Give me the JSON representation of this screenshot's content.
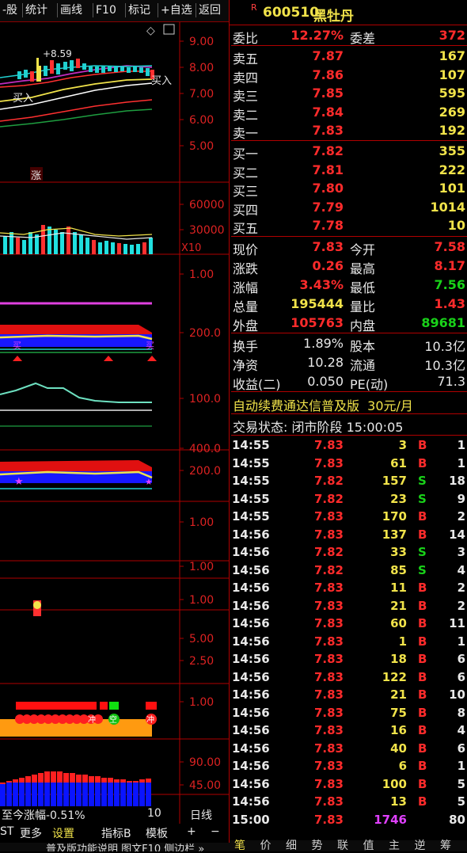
{
  "toolbar": {
    "items": [
      "-股",
      "统计",
      "画线",
      "F10",
      "标记",
      "+自选",
      "返回"
    ]
  },
  "stock": {
    "badge": "R",
    "code": "600510",
    "name": "黑牡丹"
  },
  "chart_axes": {
    "price": [
      "9.00",
      "8.00",
      "7.00",
      "6.00",
      "5.00"
    ],
    "volume": [
      "60000",
      "30000"
    ],
    "volume_mult": "X10",
    "p3": "1.00",
    "p4": "200.0",
    "p5": "100.0",
    "p6": [
      "400.0",
      "200.0"
    ],
    "p7": "1.00",
    "p8": "1.00",
    "p9": "1.00",
    "p10": [
      "5.00",
      "2.50"
    ],
    "p11": "1.00",
    "p12": [
      "90.00",
      "45.00"
    ]
  },
  "chart_labels": {
    "high_mark": "8.59",
    "buy_right": "买入",
    "buy_left": "买入",
    "zhang": "涨",
    "pos_text": "至今涨幅-0.51%",
    "period_count": "10",
    "period": "日线",
    "empty": "空",
    "stop": "冲"
  },
  "bottom": {
    "items": [
      "ST",
      "更多",
      "设置",
      "指标B",
      "模板",
      "+",
      "−"
    ],
    "ticker": "普及版功能说明 图文F10 侧边栏 »"
  },
  "quote": {
    "weibi_label": "委比",
    "weibi": "12.27%",
    "weicha_label": "委差",
    "weicha": "372",
    "asks": [
      {
        "l": "卖五",
        "p": "7.87",
        "v": "167"
      },
      {
        "l": "卖四",
        "p": "7.86",
        "v": "107"
      },
      {
        "l": "卖三",
        "p": "7.85",
        "v": "595"
      },
      {
        "l": "卖二",
        "p": "7.84",
        "v": "269"
      },
      {
        "l": "卖一",
        "p": "7.83",
        "v": "192"
      }
    ],
    "bids": [
      {
        "l": "买一",
        "p": "7.82",
        "v": "355"
      },
      {
        "l": "买二",
        "p": "7.81",
        "v": "222"
      },
      {
        "l": "买三",
        "p": "7.80",
        "v": "101"
      },
      {
        "l": "买四",
        "p": "7.79",
        "v": "1014"
      },
      {
        "l": "买五",
        "p": "7.78",
        "v": "10"
      }
    ],
    "stats": [
      {
        "l1": "现价",
        "v1": "7.83",
        "c1": "red",
        "l2": "今开",
        "v2": "7.58",
        "c2": "red"
      },
      {
        "l1": "涨跌",
        "v1": "0.26",
        "c1": "red",
        "l2": "最高",
        "v2": "8.17",
        "c2": "red"
      },
      {
        "l1": "涨幅",
        "v1": "3.43%",
        "c1": "red",
        "l2": "最低",
        "v2": "7.56",
        "c2": "green"
      },
      {
        "l1": "总量",
        "v1": "195444",
        "c1": "yel",
        "l2": "量比",
        "v2": "1.43",
        "c2": "red"
      },
      {
        "l1": "外盘",
        "v1": "105763",
        "c1": "red",
        "l2": "内盘",
        "v2": "89681",
        "c2": "green"
      }
    ],
    "fin": [
      {
        "l1": "换手",
        "v1": "1.89%",
        "l2": "股本",
        "v2": "10.3亿"
      },
      {
        "l1": "净资",
        "v1": "10.28",
        "l2": "流通",
        "v2": "10.3亿"
      },
      {
        "l1": "收益(二)",
        "v1": "0.050",
        "l2": "PE(动)",
        "v2": "71.3"
      }
    ],
    "promo": "自动续费通达信普及版  30元/月",
    "status": "交易状态: 闭市阶段 15:00:05"
  },
  "ticks": [
    [
      "14:55",
      "7.83",
      "3",
      "B",
      "1"
    ],
    [
      "14:55",
      "7.83",
      "61",
      "B",
      "1"
    ],
    [
      "14:55",
      "7.82",
      "157",
      "S",
      "18"
    ],
    [
      "14:55",
      "7.82",
      "23",
      "S",
      "9"
    ],
    [
      "14:55",
      "7.83",
      "170",
      "B",
      "2"
    ],
    [
      "14:56",
      "7.83",
      "137",
      "B",
      "14"
    ],
    [
      "14:56",
      "7.82",
      "33",
      "S",
      "3"
    ],
    [
      "14:56",
      "7.82",
      "85",
      "S",
      "4"
    ],
    [
      "14:56",
      "7.83",
      "11",
      "B",
      "2"
    ],
    [
      "14:56",
      "7.83",
      "21",
      "B",
      "2"
    ],
    [
      "14:56",
      "7.83",
      "60",
      "B",
      "11"
    ],
    [
      "14:56",
      "7.83",
      "1",
      "B",
      "1"
    ],
    [
      "14:56",
      "7.83",
      "18",
      "B",
      "6"
    ],
    [
      "14:56",
      "7.83",
      "122",
      "B",
      "6"
    ],
    [
      "14:56",
      "7.83",
      "21",
      "B",
      "10"
    ],
    [
      "14:56",
      "7.83",
      "75",
      "B",
      "8"
    ],
    [
      "14:56",
      "7.83",
      "16",
      "B",
      "4"
    ],
    [
      "14:56",
      "7.83",
      "40",
      "B",
      "6"
    ],
    [
      "14:56",
      "7.83",
      "6",
      "B",
      "1"
    ],
    [
      "14:56",
      "7.83",
      "100",
      "B",
      "5"
    ],
    [
      "14:56",
      "7.83",
      "13",
      "B",
      "5"
    ],
    [
      "15:00",
      "7.83",
      "1746",
      "",
      "80"
    ]
  ],
  "tabs": [
    "笔",
    "价",
    "细",
    "势",
    "联",
    "值",
    "主",
    "逆",
    "筹"
  ]
}
